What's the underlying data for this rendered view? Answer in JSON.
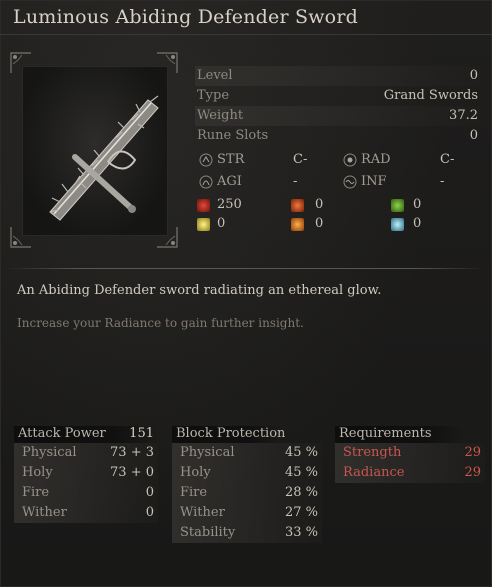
{
  "title": "Luminous Abiding Defender Sword",
  "item_image": "spiked-grand-sword-with-thorns",
  "stats": [
    {
      "label": "Level",
      "value": "0"
    },
    {
      "label": "Type",
      "value": "Grand Swords"
    },
    {
      "label": "Weight",
      "value": "37.2"
    },
    {
      "label": "Rune Slots",
      "value": "0"
    }
  ],
  "scaling": [
    {
      "icon": "str-icon",
      "label": "STR",
      "value": "C-"
    },
    {
      "icon": "rad-icon",
      "label": "RAD",
      "value": "C-"
    },
    {
      "icon": "agi-icon",
      "label": "AGI",
      "value": "-"
    },
    {
      "icon": "inf-icon",
      "label": "INF",
      "value": "-"
    }
  ],
  "affinities": [
    {
      "icon": "bleed-icon",
      "color": "#b22a1e",
      "value": "250"
    },
    {
      "icon": "burn-icon",
      "color": "#d2451c",
      "value": "0"
    },
    {
      "icon": "poison-icon",
      "color": "#5c9a2a",
      "value": "0"
    },
    {
      "icon": "radiance-icon",
      "color": "#e3d24a",
      "value": "0"
    },
    {
      "icon": "fire-burst-icon",
      "color": "#e07a1c",
      "value": "0"
    },
    {
      "icon": "frost-icon",
      "color": "#6fc3d6",
      "value": "0"
    }
  ],
  "description": "An Abiding Defender sword radiating an ethereal glow.",
  "hint": "Increase your Radiance to gain further insight.",
  "attack": {
    "header": "Attack Power",
    "total": "151",
    "rows": [
      {
        "label": "Physical",
        "value": "73 +  3"
      },
      {
        "label": "Holy",
        "value": "73 +  0"
      },
      {
        "label": "Fire",
        "value": "0"
      },
      {
        "label": "Wither",
        "value": "0"
      }
    ]
  },
  "block": {
    "header": "Block Protection",
    "rows": [
      {
        "label": "Physical",
        "value": "45 %"
      },
      {
        "label": "Holy",
        "value": "45 %"
      },
      {
        "label": "Fire",
        "value": "28 %"
      },
      {
        "label": "Wither",
        "value": "27 %"
      },
      {
        "label": "Stability",
        "value": "33 %"
      }
    ]
  },
  "requirements": {
    "header": "Requirements",
    "rows": [
      {
        "label": "Strength",
        "value": "29"
      },
      {
        "label": "Radiance",
        "value": "29"
      }
    ]
  },
  "colors": {
    "requirement_unmet": "#c9564f",
    "text": "#b9b4aa",
    "background": "#1c1b1a"
  }
}
